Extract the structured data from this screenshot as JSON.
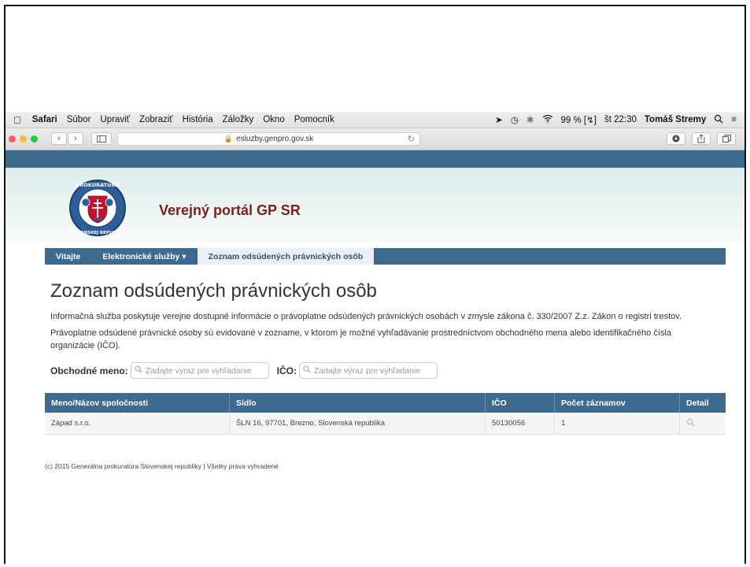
{
  "menubar": {
    "app": "Safari",
    "items": [
      "Súbor",
      "Upraviť",
      "Zobraziť",
      "História",
      "Záložky",
      "Okno",
      "Pomocník"
    ],
    "battery": "99 %",
    "clock": "št 22:30",
    "user": "Tomáš Stremy"
  },
  "browser": {
    "url": "esluzby.genpro.gov.sk"
  },
  "site": {
    "title": "Verejný portál GP SR",
    "logo_text": "PROKURATÚRA SLOVENSKEJ REPUBLIKY",
    "nav": {
      "home": "Vitajte",
      "services": "Elektronické služby ▾",
      "current": "Zoznam odsúdených právnických osôb"
    }
  },
  "page": {
    "title": "Zoznam odsúdených právnických osôb",
    "intro": "Informačná služba poskytuje verejne dostupné informácie o právoplatne odsúdených právnických osobách v zmysle zákona č. 330/2007 Z.z. Zákon o registri trestov.",
    "intro2": "Právoplatne odsúdené právnické osoby sú evidované v zozname, v ktorom je možné vyhľadávanie prostredníctvom obchodného mena alebo identifikačného čísla organizácie (IČO)."
  },
  "search": {
    "name_label": "Obchodné meno:",
    "name_placeholder": "Zadajte výraz pre vyhľadanie",
    "ico_label": "IČO:",
    "ico_placeholder": "Zadajte výraz pre vyhľadanie"
  },
  "table": {
    "headers": {
      "name": "Meno/Názov spoločnosti",
      "seat": "Sídlo",
      "ico": "IČO",
      "count": "Počet záznamov",
      "detail": "Detail"
    },
    "rows": [
      {
        "name": "Západ s.r.o.",
        "seat": "ŠLN 16, 97701, Brezno, Slovenská republika",
        "ico": "50130056",
        "count": "1"
      }
    ]
  },
  "footer": "(c) 2015 Generálna prokuratúra Slovenskej republiky | Všetky práva vyhradené",
  "colors": {
    "nav_blue": "#3e6a90",
    "title_red": "#7b1f1f"
  }
}
